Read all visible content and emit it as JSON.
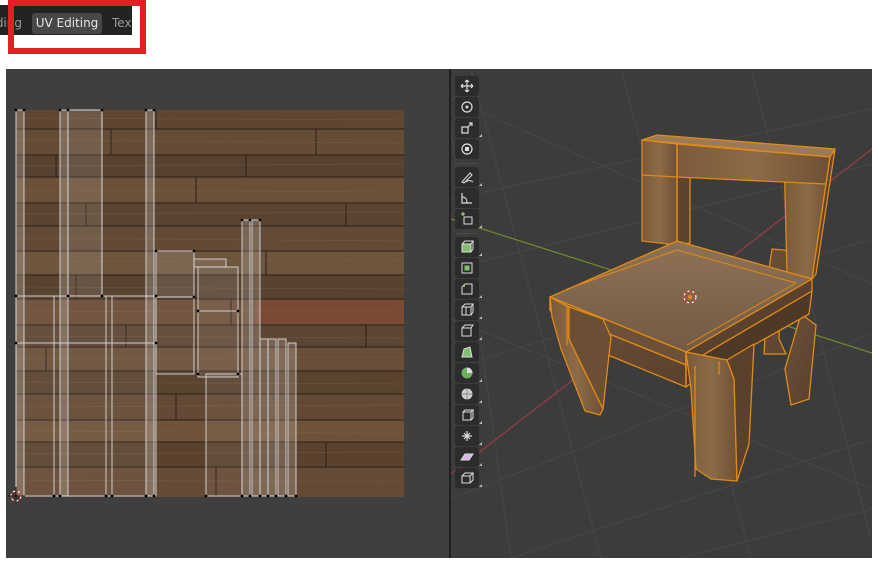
{
  "workspace_tabs": {
    "items": [
      {
        "label": "Shading",
        "visible_text": "ding",
        "active": false
      },
      {
        "label": "UV Editing",
        "active": true
      },
      {
        "label": "Texture Paint",
        "visible_text": "Text",
        "active": false
      }
    ]
  },
  "highlight_color": "#e51d25",
  "uv_editor": {
    "background_color": "#3f3f3f",
    "texture": "wood-planks"
  },
  "viewport": {
    "background_color": "#3c3c3c",
    "object": "chair",
    "toolbar_icons": [
      "move-icon",
      "rotate-icon",
      "scale-icon",
      "transform-icon",
      "annotate-icon",
      "measure-icon",
      "add-cube-icon",
      "extrude-region-icon",
      "inset-faces-icon",
      "bevel-icon",
      "loop-cut-icon",
      "knife-icon",
      "poly-build-icon",
      "spin-icon",
      "smooth-icon",
      "edge-slide-icon",
      "shrink-fatten-icon",
      "shear-icon",
      "rip-region-icon"
    ]
  }
}
